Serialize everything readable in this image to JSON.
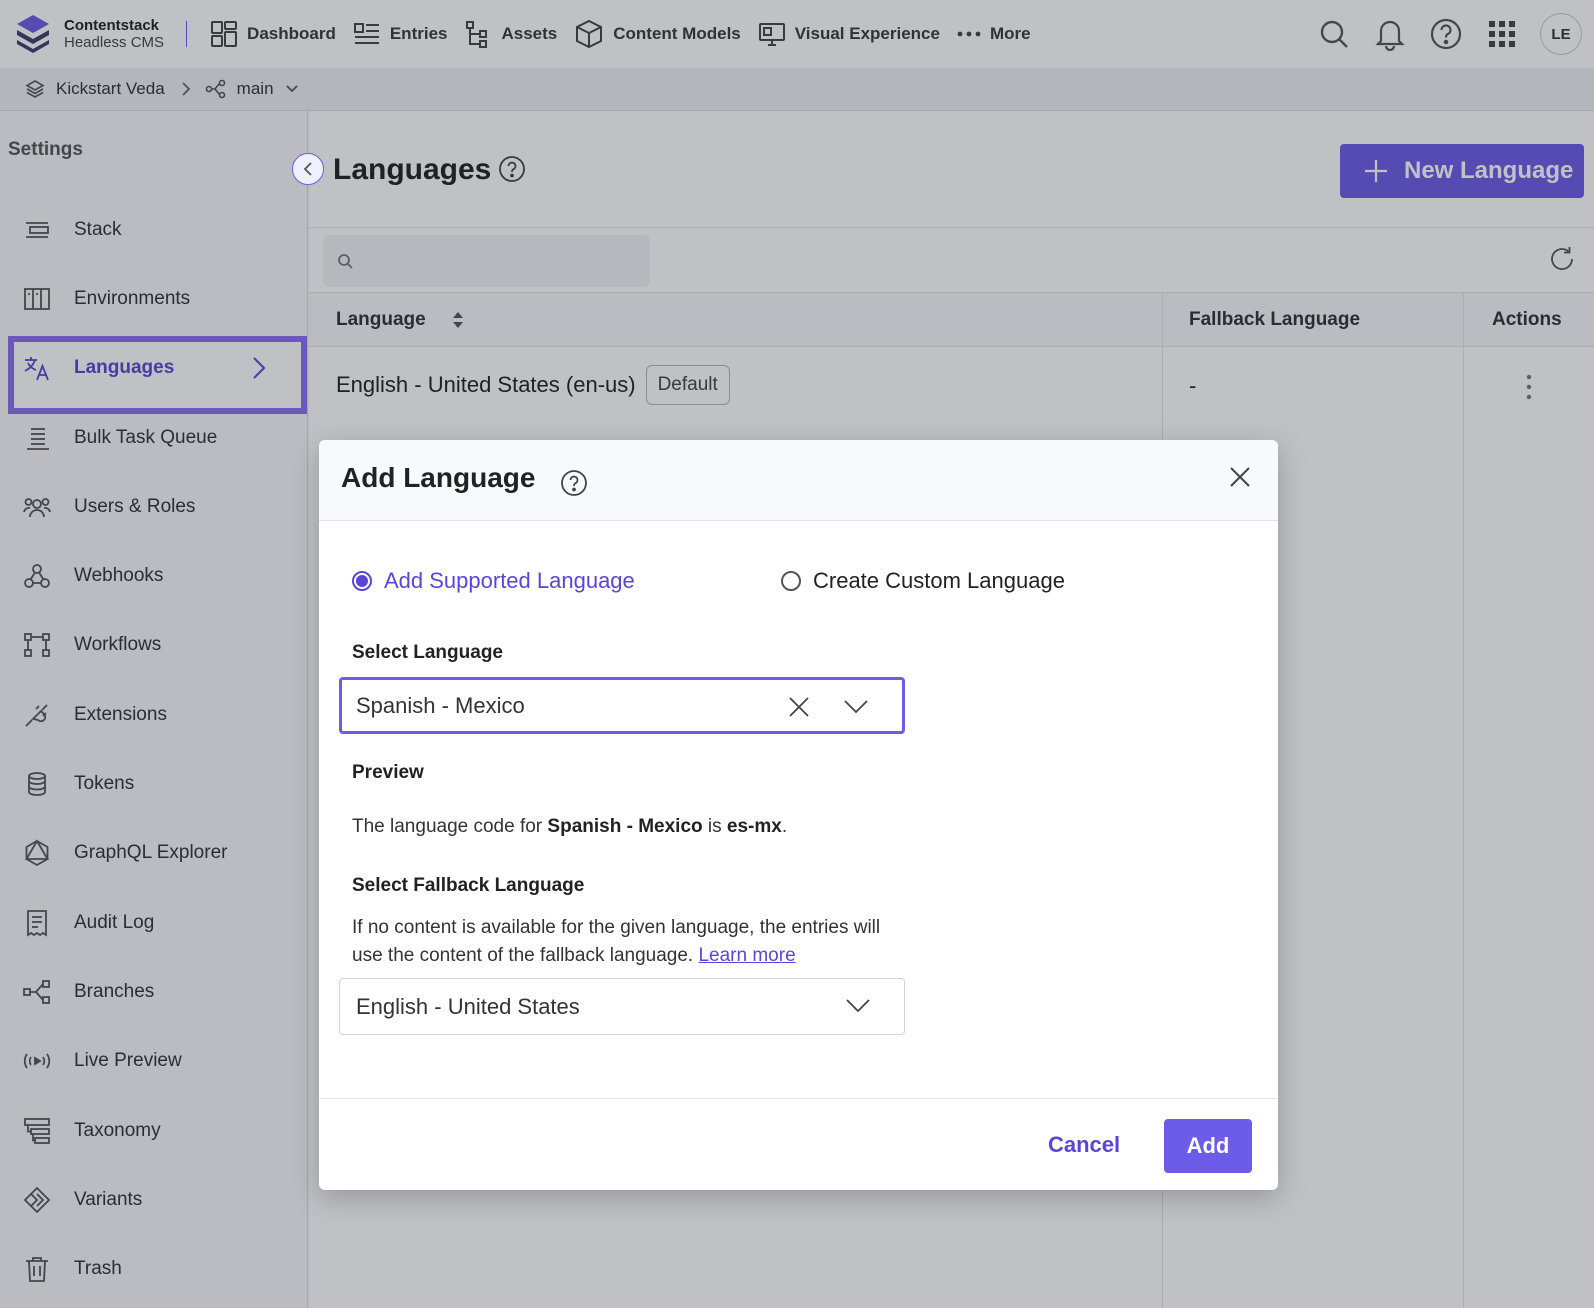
{
  "brand": {
    "name": "Contentstack",
    "subtitle": "Headless CMS"
  },
  "topnav": {
    "items": [
      {
        "label": "Dashboard",
        "icon": "dashboard-icon"
      },
      {
        "label": "Entries",
        "icon": "entries-icon"
      },
      {
        "label": "Assets",
        "icon": "assets-icon"
      },
      {
        "label": "Content Models",
        "icon": "cube-icon"
      },
      {
        "label": "Visual Experience",
        "icon": "monitor-icon"
      },
      {
        "label": "More",
        "icon": "ellipsis-icon"
      }
    ],
    "avatar_initials": "LE"
  },
  "breadcrumb": {
    "stack": "Kickstart Veda",
    "branch": "main"
  },
  "sidebar": {
    "title": "Settings",
    "items": [
      {
        "label": "Stack",
        "icon": "stack-icon"
      },
      {
        "label": "Environments",
        "icon": "environments-icon"
      },
      {
        "label": "Languages",
        "icon": "translate-icon",
        "active": true
      },
      {
        "label": "Bulk Task Queue",
        "icon": "queue-icon"
      },
      {
        "label": "Users & Roles",
        "icon": "users-icon"
      },
      {
        "label": "Webhooks",
        "icon": "webhook-icon"
      },
      {
        "label": "Workflows",
        "icon": "workflow-icon"
      },
      {
        "label": "Extensions",
        "icon": "plug-icon"
      },
      {
        "label": "Tokens",
        "icon": "database-icon"
      },
      {
        "label": "GraphQL Explorer",
        "icon": "graphql-icon"
      },
      {
        "label": "Audit Log",
        "icon": "audit-icon"
      },
      {
        "label": "Branches",
        "icon": "branch-icon"
      },
      {
        "label": "Live Preview",
        "icon": "broadcast-icon"
      },
      {
        "label": "Taxonomy",
        "icon": "taxonomy-icon"
      },
      {
        "label": "Variants",
        "icon": "variants-icon"
      },
      {
        "label": "Trash",
        "icon": "trash-icon"
      }
    ]
  },
  "main": {
    "title": "Languages",
    "new_button": "New Language",
    "search_placeholder": "",
    "columns": {
      "language": "Language",
      "fallback": "Fallback Language",
      "actions": "Actions"
    },
    "rows": [
      {
        "language": "English - United States (en-us)",
        "badge": "Default",
        "fallback": "-"
      }
    ]
  },
  "modal": {
    "title": "Add Language",
    "options": {
      "supported": "Add Supported Language",
      "custom": "Create Custom Language",
      "selected": "supported"
    },
    "select_language_label": "Select Language",
    "selected_language": "Spanish - Mexico",
    "preview_label": "Preview",
    "preview": {
      "prefix": "The language code for ",
      "language": "Spanish - Mexico",
      "middle": " is ",
      "code": "es-mx",
      "suffix": "."
    },
    "fallback_label": "Select Fallback Language",
    "fallback_desc": "If no content is available for the given language, the entries will use the content of the fallback language.",
    "learn_more": "Learn more",
    "fallback_value": "English - United States",
    "cancel": "Cancel",
    "add": "Add"
  },
  "colors": {
    "accent": "#6c5ce7",
    "accent_text": "#5b45d6",
    "active_outline": "#8b6cf2"
  }
}
